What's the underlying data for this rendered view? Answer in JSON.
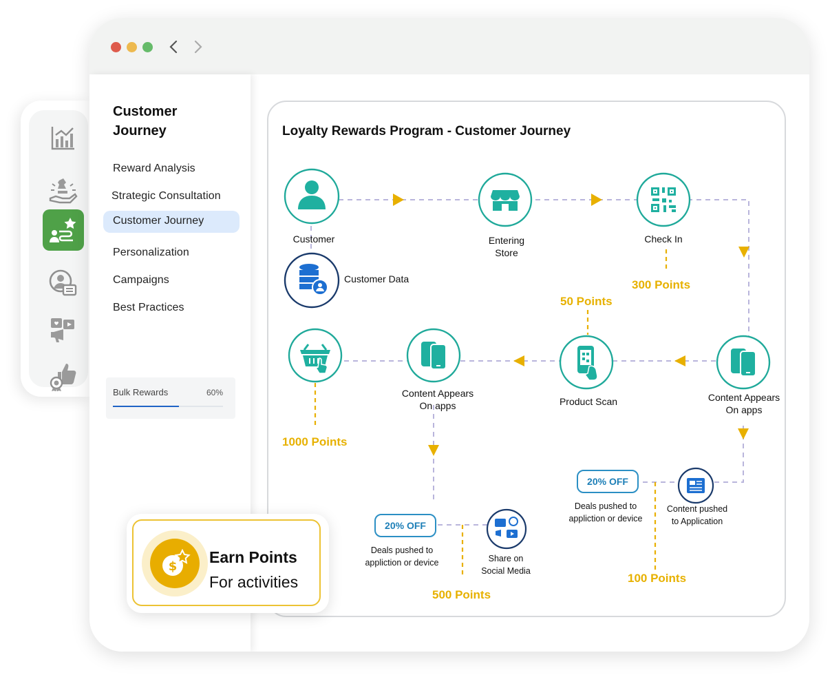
{
  "sidebar_menu": {
    "title": "Customer\nJourney",
    "items": [
      {
        "label": "Reward Analysis"
      },
      {
        "label": "Strategic Consultation"
      },
      {
        "label": "Customer Journey"
      },
      {
        "label": "Personalization"
      },
      {
        "label": "Campaigns"
      },
      {
        "label": "Best Practices"
      }
    ],
    "active_item": "Customer Journey",
    "bulk_rewards": {
      "label": "Bulk Rewards",
      "percent_text": "60%",
      "progress": 0.6
    }
  },
  "icon_rail": {
    "icons": [
      "analytics-chart-icon",
      "strategy-chess-hand-icon",
      "journey-star-icon",
      "customer-profile-icon",
      "social-media-icon",
      "badge-thumbs-up-icon"
    ],
    "active_index": 2,
    "active_color": "#4fa148"
  },
  "diagram": {
    "title": "Loyalty Rewards Program - Customer Journey",
    "nodes": {
      "customer": "Customer",
      "customer_data": "Customer Data",
      "entering_store": "Entering\nStore",
      "check_in": "Check In",
      "content_apps_right": "Content Appears\nOn apps",
      "product_scan": "Product Scan",
      "content_apps_left": "Content Appears\nOn apps",
      "shopping": "",
      "share_social": "Share on\nSocial Media",
      "content_pushed": "Content pushed\nto Application",
      "deals_left": "Deals pushed to\nappliction or device",
      "deals_right": "Deals pushed to\nappliction or device"
    },
    "badges": {
      "off_left": "20% OFF",
      "off_right": "20% OFF"
    },
    "points": {
      "check_in": "300 Points",
      "product_scan": "50 Points",
      "shopping": "1000 Points",
      "social": "500 Points",
      "content_pushed": "100 Points"
    },
    "colors": {
      "node_ring": "#1fa99a",
      "node_icon": "#1fb0a0",
      "arrow": "#e8b000",
      "connector": "#b9b5dc",
      "points": "#e7b100",
      "badge": "#2b8fc4"
    }
  },
  "earn_card": {
    "title": "Earn Points",
    "subtitle": "For activities"
  }
}
